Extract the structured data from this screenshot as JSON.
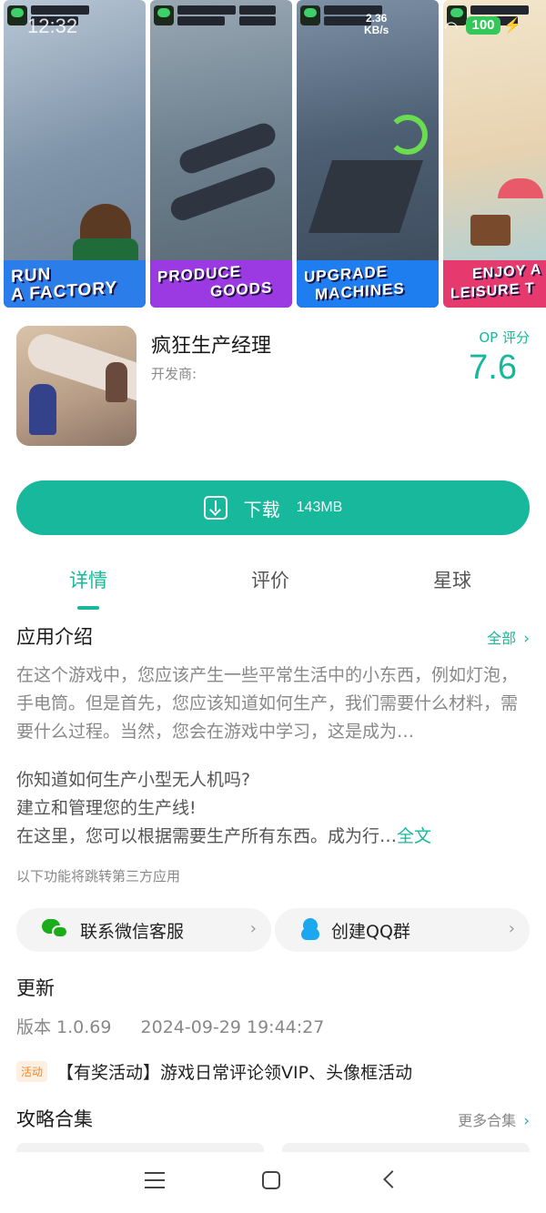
{
  "status_bar": {
    "time": "12:32",
    "net_speed_value": "2.36",
    "net_speed_unit": "KB/s",
    "battery": "100"
  },
  "screenshots": [
    {
      "caption_line1": "RUN",
      "caption_line2": "A FACTORY",
      "banner_color": "#2b7de9",
      "scene_color": "#8ea2b8"
    },
    {
      "caption_line1": "PRODUCE",
      "caption_line2": "GOODS",
      "banner_color": "#9b39e3",
      "scene_color": "#6f8290"
    },
    {
      "caption_line1": "UPGRADE",
      "caption_line2": "MACHINES",
      "banner_color": "#1e7ef0",
      "scene_color": "#4d5f73"
    },
    {
      "caption_line1": "ENJOY A",
      "caption_line2": "LEISURE T",
      "banner_color": "#e63a6e",
      "scene_color": "#e7d2b0"
    }
  ],
  "app": {
    "title": "疯狂生产经理",
    "developer_label": "开发商:",
    "rating_label": "OP 评分",
    "rating_value": "7.6"
  },
  "download": {
    "label": "下载",
    "size": "143MB"
  },
  "tabs": [
    {
      "label": "详情",
      "active": true
    },
    {
      "label": "评价",
      "active": false
    },
    {
      "label": "星球",
      "active": false
    }
  ],
  "intro": {
    "title": "应用介绍",
    "more_label": "全部",
    "summary": "在这个游戏中，您应该产生一些平常生活中的小东西，例如灯泡，手电筒。但是首先，您应该知道如何生产，我们需要什么材料，需要什么过程。当然，您会在游戏中学习，这是成为…",
    "line1": "你知道如何生产小型无人机吗?",
    "line2": "建立和管理您的生产线!",
    "line3": "在这里，您可以根据需要生产所有东西。成为行…",
    "full_text_label": "全文",
    "third_party_note": "以下功能将跳转第三方应用"
  },
  "actions": {
    "wechat_label": "联系微信客服",
    "qq_label": "创建QQ群"
  },
  "update": {
    "title": "更新",
    "version": "版本 1.0.69",
    "date": "2024-09-29 19:44:27"
  },
  "event": {
    "tag": "活动",
    "text": "【有奖活动】游戏日常评论领VIP、头像框活动"
  },
  "guides": {
    "title": "攻略合集",
    "more_label": "更多合集"
  },
  "colors": {
    "accent": "#17b89b",
    "rating": "#16b89a",
    "event_tag": "#f08a2a"
  }
}
